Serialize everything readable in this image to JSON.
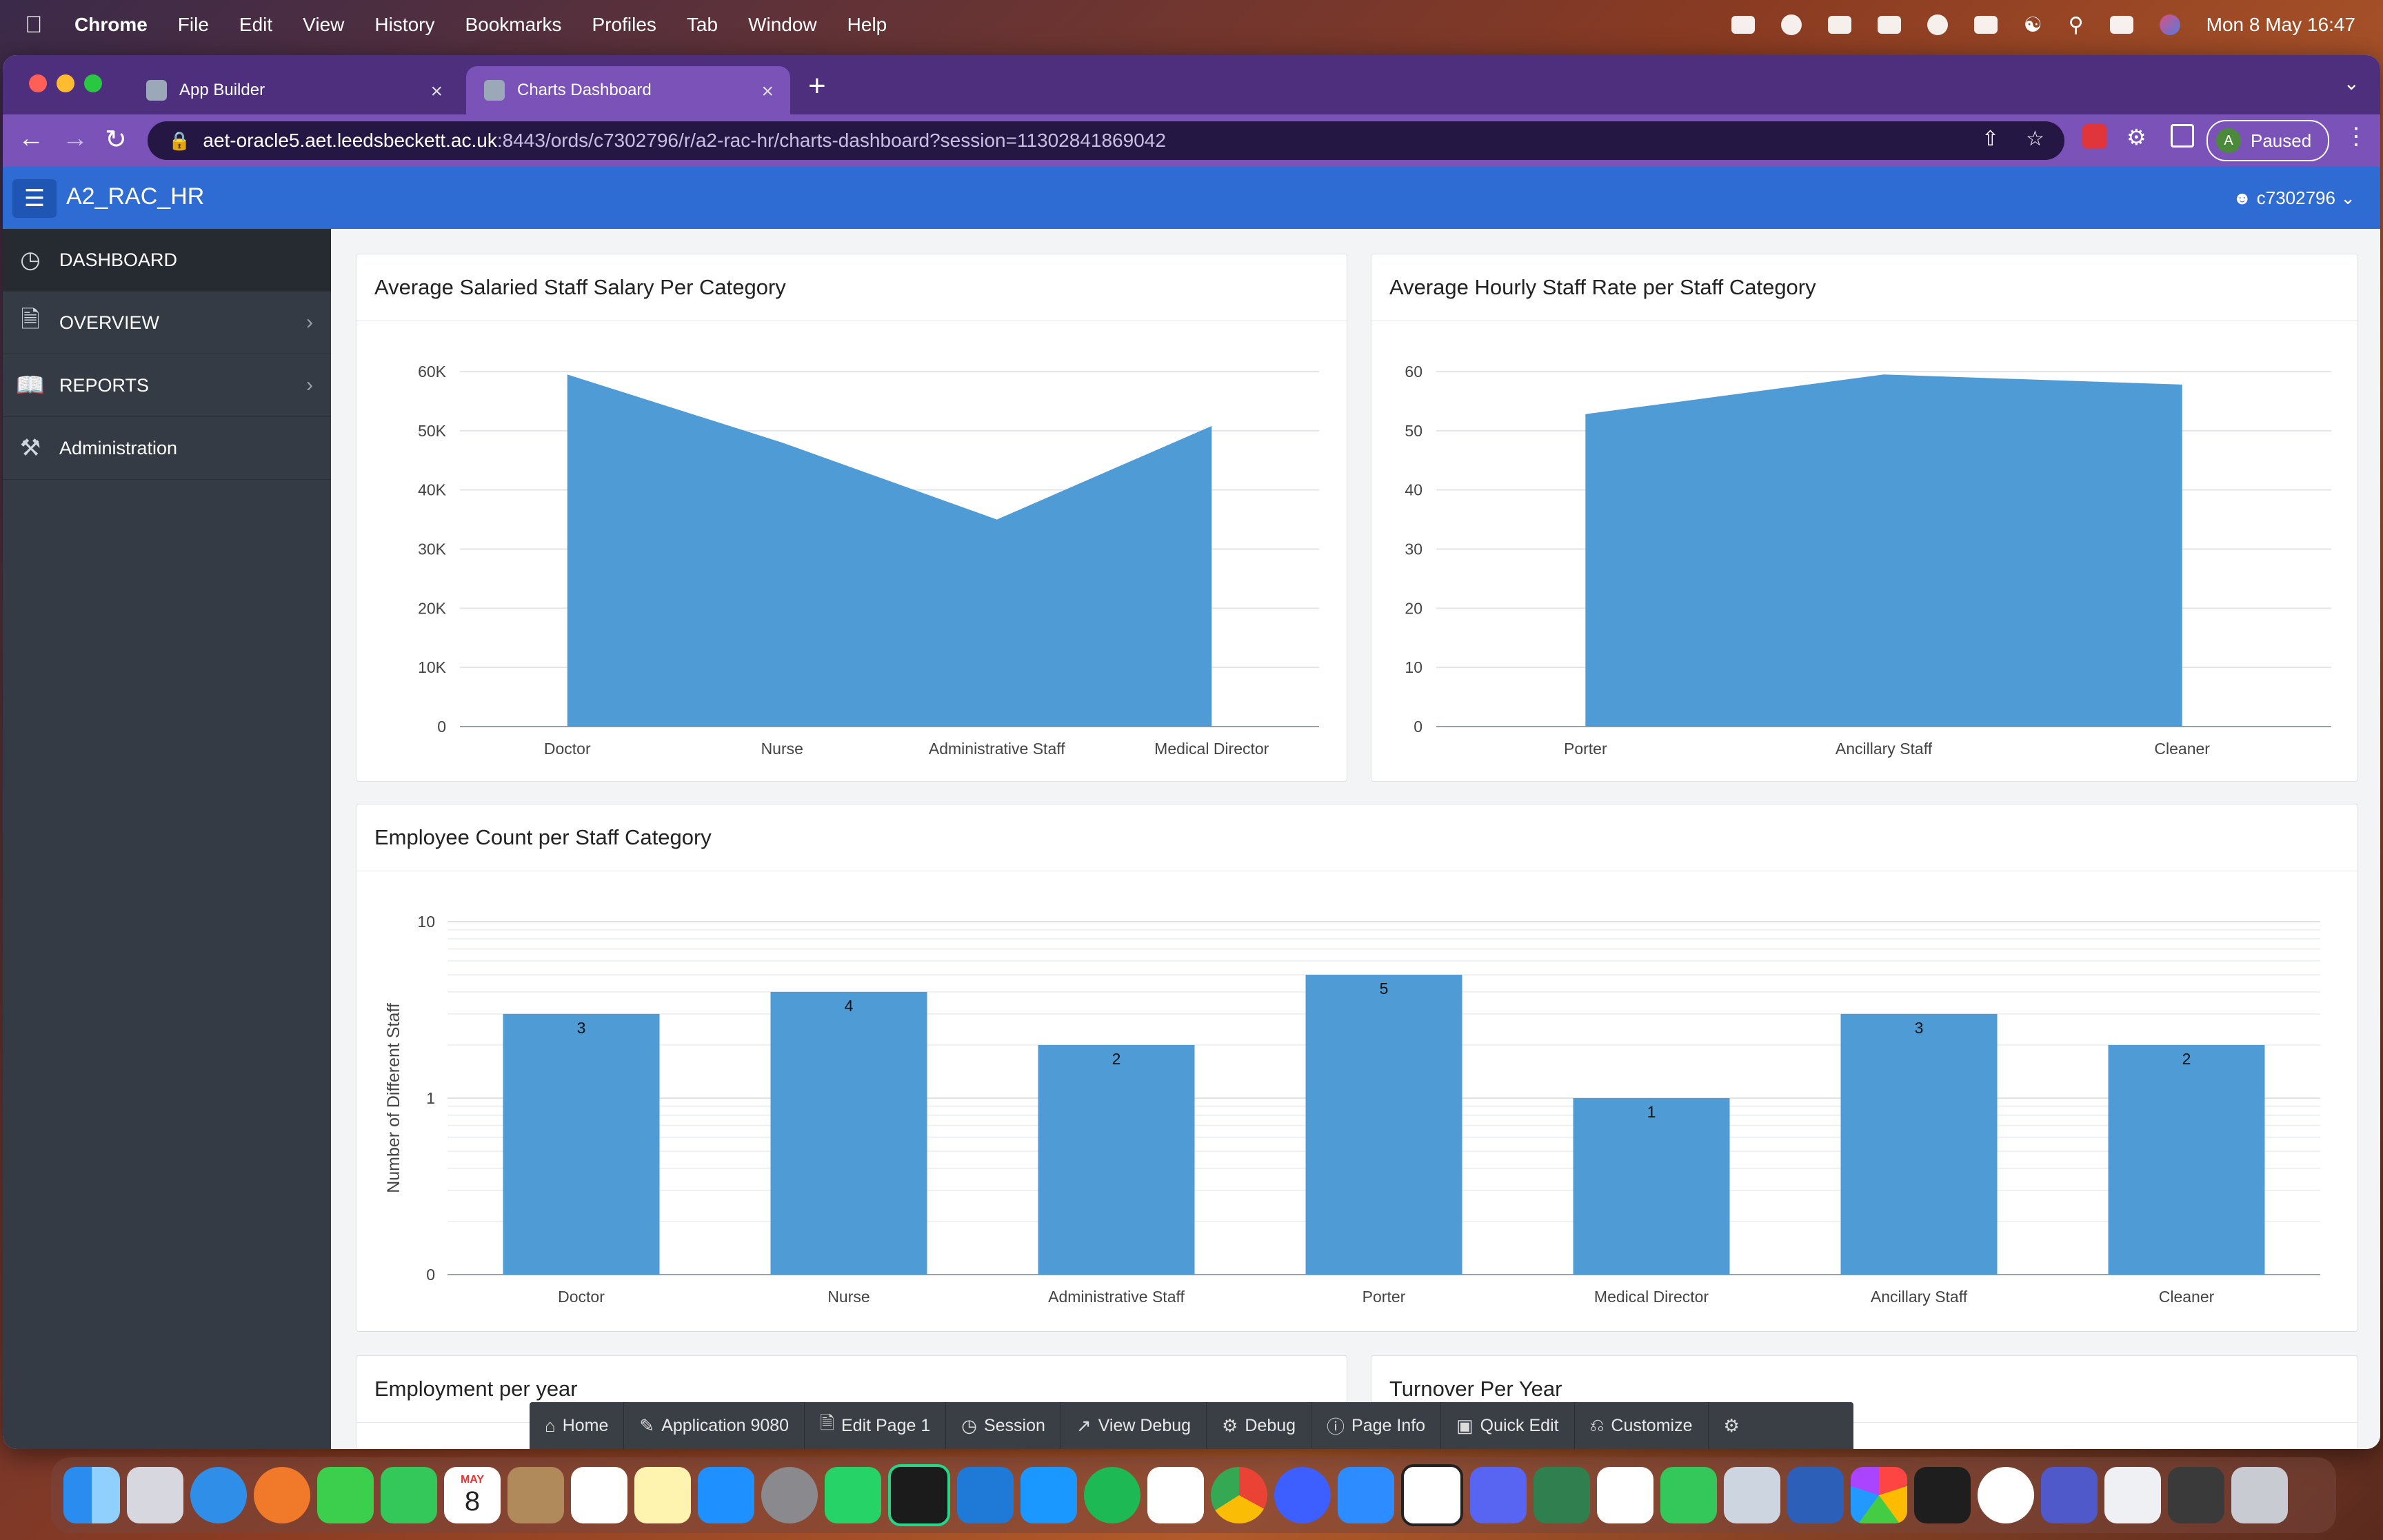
{
  "menubar": {
    "app": "Chrome",
    "items": [
      "File",
      "Edit",
      "View",
      "History",
      "Bookmarks",
      "Profiles",
      "Tab",
      "Window",
      "Help"
    ],
    "clock": "Mon 8 May  16:47"
  },
  "browser": {
    "tabs": [
      {
        "title": "App Builder"
      },
      {
        "title": "Charts Dashboard"
      }
    ],
    "url_host": "aet-oracle5.aet.leedsbeckett.ac.uk",
    "url_path": ":8443/ords/c7302796/r/a2-rac-hr/charts-dashboard?session=11302841869042",
    "profile_initial": "A",
    "profile_status": "Paused"
  },
  "apex": {
    "app_title": "A2_RAC_HR",
    "user": "c7302796"
  },
  "sidebar": {
    "items": [
      {
        "label": "DASHBOARD",
        "icon": "dashboard-gauge-icon",
        "active": true,
        "has_children": false
      },
      {
        "label": "OVERVIEW",
        "icon": "document-icon",
        "active": false,
        "has_children": true
      },
      {
        "label": "REPORTS",
        "icon": "book-icon",
        "active": false,
        "has_children": true
      },
      {
        "label": "Administration",
        "icon": "user-wrench-icon",
        "active": false,
        "has_children": false
      }
    ]
  },
  "cards": {
    "salary_title": "Average Salaried Staff Salary Per Category",
    "hourly_title": "Average Hourly Staff Rate per Staff Category",
    "count_title": "Employee Count per Staff Category",
    "employment_title": "Employment per year",
    "turnover_title": "Turnover Per Year"
  },
  "chart_data": [
    {
      "type": "area",
      "title": "Average Salaried Staff Salary Per Category",
      "categories": [
        "Doctor",
        "Nurse",
        "Administrative Staff",
        "Medical Director"
      ],
      "values": [
        59500,
        48000,
        35000,
        50800
      ],
      "yticks": [
        "0",
        "10K",
        "20K",
        "30K",
        "40K",
        "50K",
        "60K"
      ],
      "ylim": [
        0,
        60000
      ],
      "grid": true,
      "color": "#4f9bd6"
    },
    {
      "type": "area",
      "title": "Average Hourly Staff Rate per Staff Category",
      "categories": [
        "Porter",
        "Ancillary Staff",
        "Cleaner"
      ],
      "values": [
        52.8,
        59.5,
        57.8
      ],
      "yticks": [
        "0",
        "10",
        "20",
        "30",
        "40",
        "50",
        "60"
      ],
      "ylim": [
        0,
        60
      ],
      "grid": true,
      "color": "#4f9bd6"
    },
    {
      "type": "bar",
      "title": "Employee Count per Staff Category",
      "categories": [
        "Doctor",
        "Nurse",
        "Administrative Staff",
        "Porter",
        "Medical Director",
        "Ancillary Staff",
        "Cleaner"
      ],
      "values": [
        3,
        4,
        2,
        5,
        1,
        3,
        2
      ],
      "value_labels": [
        "3",
        "4",
        "2",
        "5",
        "1",
        "3",
        "2"
      ],
      "ylabel": "Number of Different Staff",
      "yscale": "log",
      "yticks": [
        "0",
        "1",
        "10"
      ],
      "grid": true,
      "color": "#4f9bd6"
    }
  ],
  "devbar": {
    "items": [
      {
        "label": "Home",
        "icon": "home-icon"
      },
      {
        "label": "Application 9080",
        "icon": "edit-icon"
      },
      {
        "label": "Edit Page 1",
        "icon": "edit-page-icon"
      },
      {
        "label": "Session",
        "icon": "session-icon"
      },
      {
        "label": "View Debug",
        "icon": "external-link-icon"
      },
      {
        "label": "Debug",
        "icon": "bug-icon"
      },
      {
        "label": "Page Info",
        "icon": "info-icon"
      },
      {
        "label": "Quick Edit",
        "icon": "quick-edit-icon"
      },
      {
        "label": "Customize",
        "icon": "paint-roller-icon"
      }
    ]
  },
  "dock": {
    "calendar_month": "MAY",
    "calendar_day": "8"
  }
}
